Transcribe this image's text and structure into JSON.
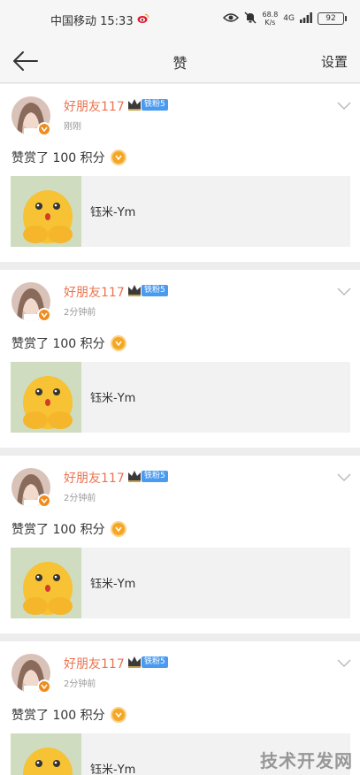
{
  "status_bar": {
    "carrier_time": "中国移动 15:33",
    "net_speed_value": "68.8",
    "net_speed_unit": "K/s",
    "network": "4G",
    "battery": "92"
  },
  "nav": {
    "title": "赞",
    "settings_label": "设置"
  },
  "cards": [
    {
      "username": "好朋友117",
      "fan_badge": "铁粉5",
      "time": "刚刚",
      "reward_text": "赞赏了 100 积分",
      "post_author": "钰米-Ym"
    },
    {
      "username": "好朋友117",
      "fan_badge": "铁粉5",
      "time": "2分钟前",
      "reward_text": "赞赏了 100 积分",
      "post_author": "钰米-Ym"
    },
    {
      "username": "好朋友117",
      "fan_badge": "铁粉5",
      "time": "2分钟前",
      "reward_text": "赞赏了 100 积分",
      "post_author": "钰米-Ym"
    },
    {
      "username": "好朋友117",
      "fan_badge": "铁粉5",
      "time": "2分钟前",
      "reward_text": "赞赏了 100 积分",
      "post_author": "钰米-Ym"
    }
  ],
  "watermark": "技术开发网",
  "colors": {
    "username": "#eb7350",
    "fan_badge": "#4a9bf0",
    "coin": "#f5a623",
    "verified": "#f08c1d"
  }
}
